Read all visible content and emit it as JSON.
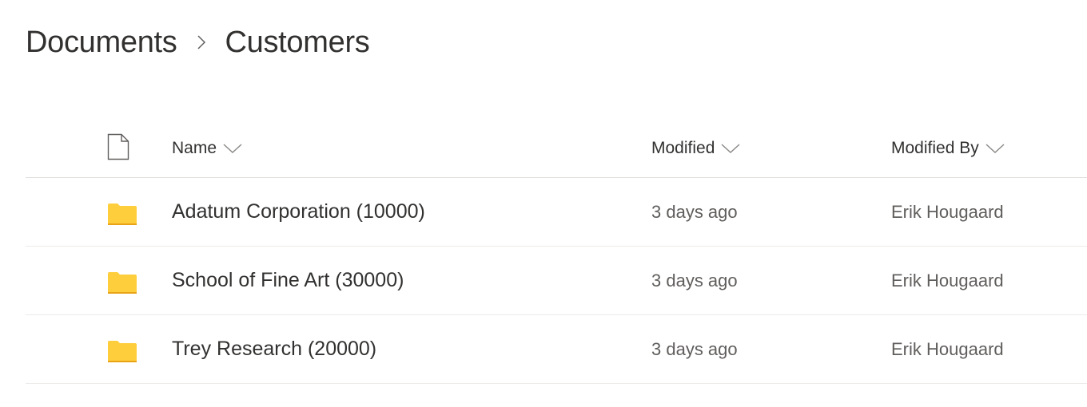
{
  "breadcrumb": {
    "items": [
      {
        "label": "Documents"
      },
      {
        "label": "Customers"
      }
    ],
    "separator_icon": "chevron-right-icon"
  },
  "columns": {
    "type_icon": "file-icon",
    "name": "Name",
    "modified": "Modified",
    "modified_by": "Modified By",
    "sort_icon": "chevron-down-icon"
  },
  "rows": [
    {
      "icon": "folder-icon",
      "name": "Adatum Corporation (10000)",
      "modified": "3 days ago",
      "modified_by": "Erik Hougaard"
    },
    {
      "icon": "folder-icon",
      "name": "School of Fine Art (30000)",
      "modified": "3 days ago",
      "modified_by": "Erik Hougaard"
    },
    {
      "icon": "folder-icon",
      "name": "Trey Research (20000)",
      "modified": "3 days ago",
      "modified_by": "Erik Hougaard"
    }
  ],
  "colors": {
    "folder": "#ffce3d",
    "folder_edge": "#e8a317",
    "text": "#323130",
    "meta_text": "#605e5c",
    "divider": "#edebe9"
  }
}
